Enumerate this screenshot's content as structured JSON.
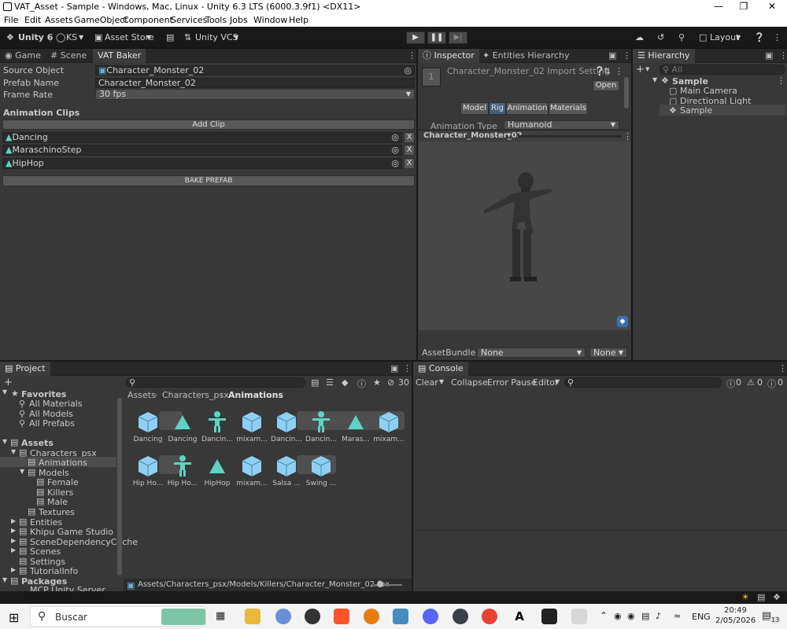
{
  "window": {
    "title": "VAT_Asset - Sample - Windows, Mac, Linux - Unity 6.3 LTS (6000.3.9f1) <DX11>"
  },
  "menu": [
    "File",
    "Edit",
    "Assets",
    "GameObject",
    "Component",
    "Services",
    "Tools",
    "Jobs",
    "Window",
    "Help"
  ],
  "toolbar": {
    "unity_label": "Unity 6",
    "account": "KS",
    "asset_store": "Asset Store",
    "vcs": "Unity VCS",
    "layout": "Layout"
  },
  "vat": {
    "tabs": [
      "Game",
      "Scene",
      "VAT Baker"
    ],
    "source_label": "Source Object",
    "source_value": "Character_Monster_02",
    "prefab_label": "Prefab Name",
    "prefab_value": "Character_Monster_02",
    "fps_label": "Frame Rate",
    "fps_value": "30 fps",
    "clips_header": "Animation Clips",
    "add_clip": "Add Clip",
    "clips": [
      "Dancing",
      "MaraschinoStep",
      "HipHop"
    ],
    "remove": "X",
    "bake": "BAKE PREFAB"
  },
  "inspector": {
    "tab": "Inspector",
    "tab2": "Entities Hierarchy",
    "title": "Character_Monster_02 Import Setting",
    "open": "Open",
    "subtabs": [
      "Model",
      "Rig",
      "Animation",
      "Materials"
    ],
    "anim_type_label": "Animation Type",
    "anim_type_value": "Humanoid",
    "preview_name": "Character_Monster_02",
    "assetbundle_label": "AssetBundle",
    "assetbundle_value": "None",
    "assetbundle_variant": "None"
  },
  "hierarchy": {
    "tab": "Hierarchy",
    "search": "All",
    "scene": "Sample",
    "items": [
      "Main Camera",
      "Directional Light",
      "Sample"
    ]
  },
  "project": {
    "tab": "Project",
    "favorites": "Favorites",
    "fav_items": [
      "All Materials",
      "All Models",
      "All Prefabs"
    ],
    "assets": "Assets",
    "tree": [
      "Characters_psx",
      "Animations",
      "Models",
      "Female",
      "Killers",
      "Male",
      "Textures",
      "Entities",
      "Khipu Game Studio",
      "SceneDependencyCache",
      "Scenes",
      "Settings",
      "TutorialInfo"
    ],
    "packages": "Packages",
    "package_cut": "MCP Unity Server",
    "breadcrumb": [
      "Assets",
      "Characters_psx",
      "Animations"
    ],
    "count": "30",
    "assets_row1": [
      "Dancing",
      "Dancing",
      "Dancin...",
      "mixam...",
      "Dancin...",
      "Dancin...",
      "Maras...",
      "mixam..."
    ],
    "assets_row2": [
      "Hip Ho...",
      "Hip Ho...",
      "HipHop",
      "mixam...",
      "Salsa ...",
      "Swing ..."
    ],
    "status_path": "Assets/Characters_psx/Models/Killers/Character_Monster_02.fbx"
  },
  "console": {
    "tab": "Console",
    "clear": "Clear",
    "collapse": "Collapse",
    "error_pause": "Error Pause",
    "editor": "Editor",
    "n1": "0",
    "n2": "0",
    "n3": "0"
  },
  "taskbar": {
    "search": "Buscar",
    "lang": "ENG",
    "time": "20:49",
    "date": "2/05/2026",
    "notif": "13"
  },
  "colors": {
    "accent": "#4a6b98",
    "panel": "#383838",
    "dark": "#191919",
    "teal": "#5ed3c4"
  }
}
